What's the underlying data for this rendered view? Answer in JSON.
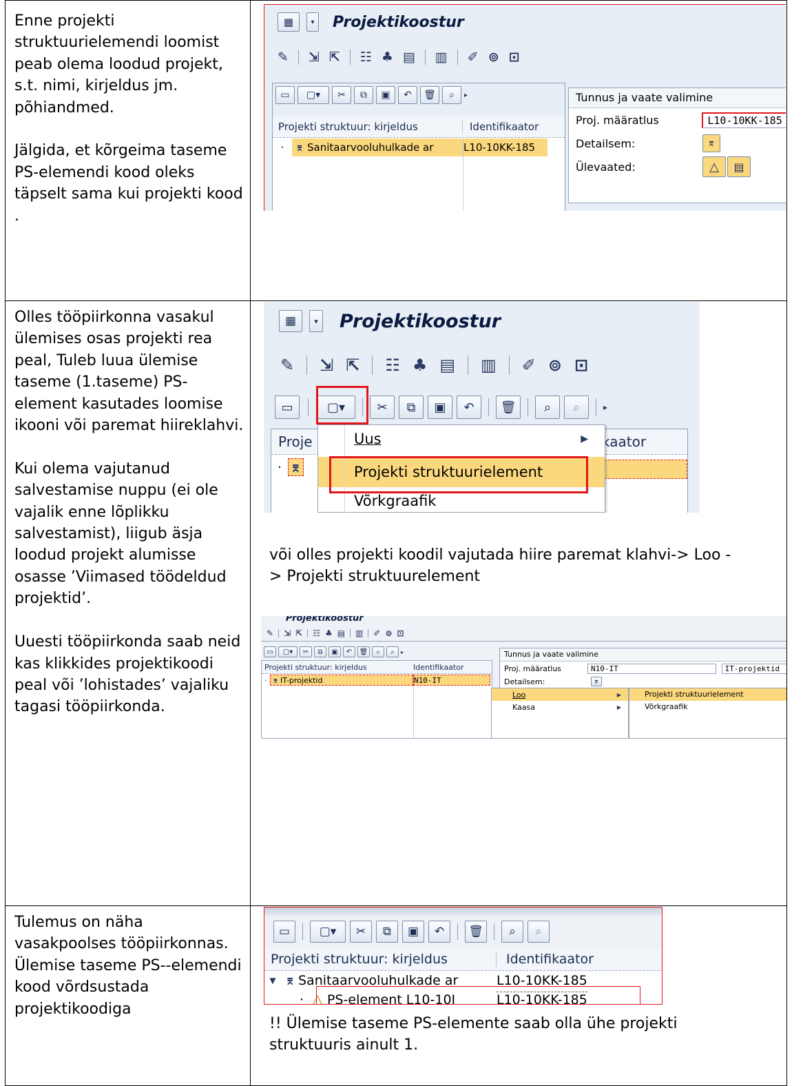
{
  "rows": [
    {
      "left_text": "Enne projekti struktuurielemendi loomist peab olema loodud projekt, s.t. nimi, kirjeldus jm. põhiandmed.\n\nJälgida, et kõrgeima taseme PS-elemendi kood oleks täpselt sama kui projekti kood ."
    },
    {
      "left_text": "Olles tööpiirkonna vasakul ülemises osas projekti rea peal, Tuleb luua ülemise taseme (1.taseme) PS-element kasutades loomise ikooni või paremat hiireklahvi.\n\nKui olema vajutanud salvestamise nuppu (ei ole vajalik enne lõplikku salvestamist), liigub äsja loodud projekt alumisse osasse ’Viimased töödeldud projektid’.\n\nUuesti tööpiirkonda saab neid kas klikkides projektikoodi peal või ’lohistades’ vajaliku tagasi tööpiirkonda.",
      "right_text": "või olles projekti koodil vajutada hiire paremat klahvi-> Loo -> Projekti struktuurelement"
    },
    {
      "left_text": "Tulemus on näha vasakpoolses tööpiirkonnas.\nÜlemise taseme PS--elemendi kood võrdsustada projektikoodiga",
      "right_text": "!! Ülemise taseme PS-elemente saab olla ühe projekti struktuuris ainult 1."
    }
  ],
  "shot1": {
    "title": "Projektikoostur",
    "tree_headers": [
      "Projekti struktuur: kirjeldus",
      "Identifikaator"
    ],
    "tree_row": {
      "description": "Sanitaarvooluhulkade ar",
      "identifier": "L10-10KK-185"
    },
    "side_header": "Tunnus ja vaate valimine",
    "fields": [
      {
        "label": "Proj. määratlus",
        "value": "L10-10KK-185"
      },
      {
        "label": "Detailsem:"
      },
      {
        "label": "Ülevaated:"
      }
    ]
  },
  "shot2": {
    "title": "Projektikoostur",
    "tree_header_left": "Proje",
    "tree_header_right": "kaator",
    "menu_items": [
      "Uus",
      "Projekti struktuurielement",
      "Võrkgraafik"
    ]
  },
  "shot3": {
    "title": "Projektikoostur",
    "tree_headers": [
      "Projekti struktuur: kirjeldus",
      "Identifikaator"
    ],
    "tree_row": {
      "description": "IT-projektid",
      "identifier": "N10-IT"
    },
    "side_header": "Tunnus ja vaate valimine",
    "field_label": "Proj. määratlus",
    "field_value": "N10-IT",
    "field_desc": "IT-projektid",
    "detail_label": "Detailsem:",
    "context_menu": [
      "Loo",
      "Kaasa"
    ],
    "submenu": [
      "Projekti struktuurielement",
      "Võrkgraafik"
    ]
  },
  "shot4": {
    "tree_headers": [
      "Projekti struktuur: kirjeldus",
      "Identifikaator"
    ],
    "rows": [
      {
        "description": "Sanitaarvooluhulkade ar",
        "identifier": "L10-10KK-185"
      },
      {
        "description": "PS-element L10-10I",
        "identifier": "L10-10KK-185"
      }
    ]
  }
}
